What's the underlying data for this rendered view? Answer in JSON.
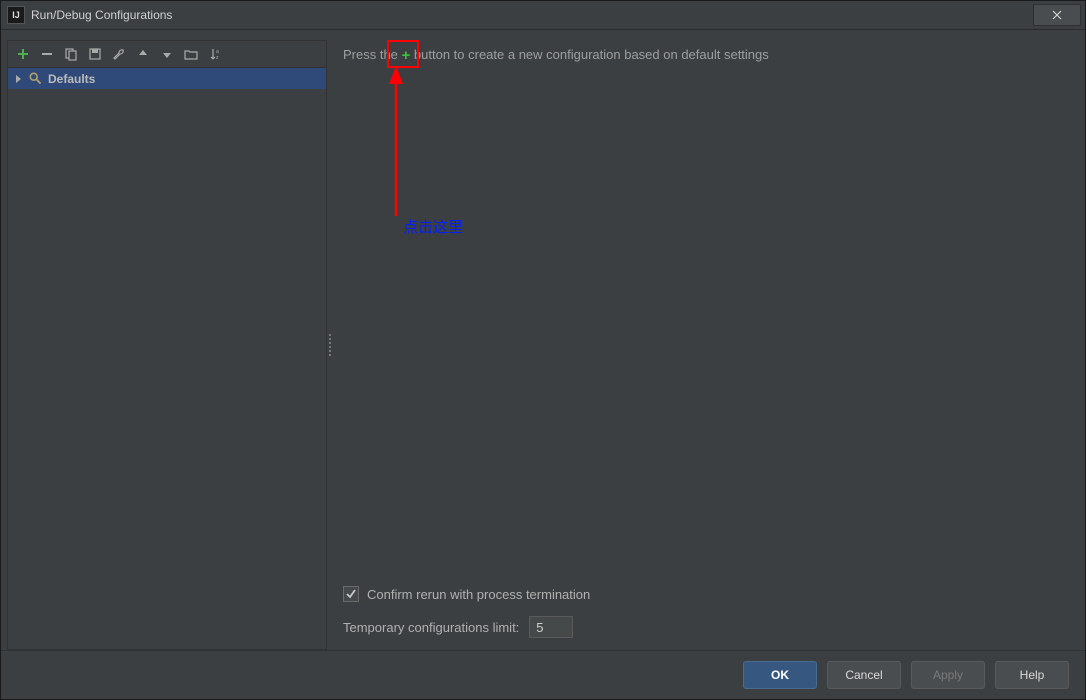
{
  "title": "Run/Debug Configurations",
  "toolbar": {
    "add": "add",
    "remove": "remove",
    "copy": "copy",
    "save": "save",
    "wrench": "edit-defaults",
    "up": "move-up",
    "down": "move-down",
    "folder": "folder",
    "sort": "sort-alpha"
  },
  "tree": {
    "defaults_label": "Defaults"
  },
  "hint": {
    "prefix": "Press the ",
    "plus": "+",
    "suffix": " button to create a new configuration based on default settings"
  },
  "annotation": {
    "text": "点击这里"
  },
  "options": {
    "checkbox_label": "Confirm rerun with process termination",
    "checkbox_checked": true,
    "limit_label": "Temporary configurations limit:",
    "limit_value": "5"
  },
  "buttons": {
    "ok": "OK",
    "cancel": "Cancel",
    "apply": "Apply",
    "help": "Help"
  }
}
